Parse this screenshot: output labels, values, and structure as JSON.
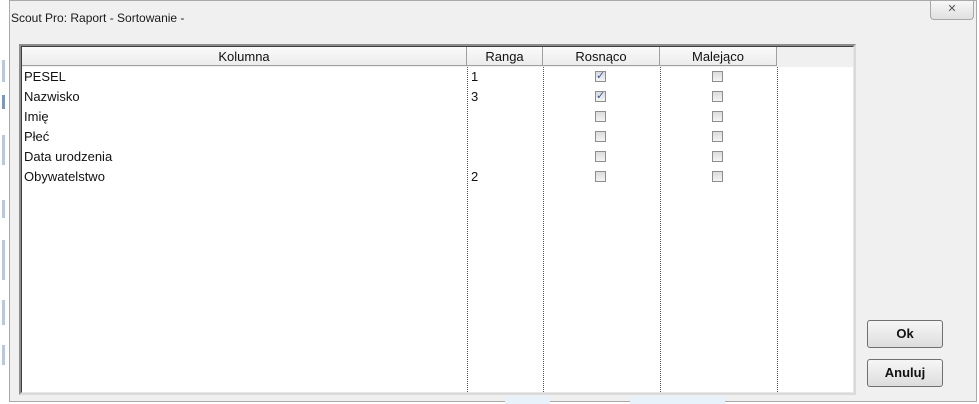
{
  "window": {
    "title": "Scout Pro: Raport - Sortowanie -",
    "close_label": "✕"
  },
  "table": {
    "headers": {
      "kolumna": "Kolumna",
      "ranga": "Ranga",
      "rosnaco": "Rosnąco",
      "malejaco": "Malejąco"
    },
    "rows": [
      {
        "kolumna": "PESEL",
        "ranga": "1",
        "rosnaco": true,
        "malejaco": false
      },
      {
        "kolumna": "Nazwisko",
        "ranga": "3",
        "rosnaco": true,
        "malejaco": false
      },
      {
        "kolumna": "Imię",
        "ranga": "",
        "rosnaco": false,
        "malejaco": false
      },
      {
        "kolumna": "Płeć",
        "ranga": "",
        "rosnaco": false,
        "malejaco": false
      },
      {
        "kolumna": "Data urodzenia",
        "ranga": "",
        "rosnaco": false,
        "malejaco": false
      },
      {
        "kolumna": "Obywatelstwo",
        "ranga": "2",
        "rosnaco": false,
        "malejaco": false
      }
    ],
    "check_mark": "✓"
  },
  "buttons": {
    "ok_label": "Ok",
    "cancel_label": "Anuluj"
  },
  "colors": {
    "window_bg": "#f0f0f0",
    "check_color": "#3c58a0",
    "border_dark": "#8c8c8c"
  }
}
